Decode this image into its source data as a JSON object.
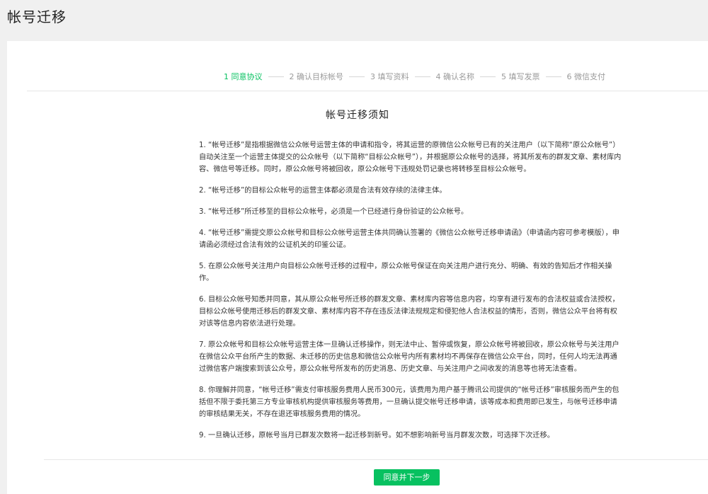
{
  "page": {
    "title": "帐号迁移"
  },
  "steps": [
    {
      "label": "1 同意协议",
      "active": true
    },
    {
      "label": "2 确认目标帐号",
      "active": false
    },
    {
      "label": "3 填写资料",
      "active": false
    },
    {
      "label": "4 确认名称",
      "active": false
    },
    {
      "label": "5 填写发票",
      "active": false
    },
    {
      "label": "6 微信支付",
      "active": false
    }
  ],
  "notice": {
    "title": "帐号迁移须知",
    "terms": [
      "1. “帐号迁移”是指根据微信公众帐号运营主体的申请和指令，将其运营的原微信公众帐号已有的关注用户（以下简称“原公众帐号”）自动关注至一个运营主体提交的公众帐号（以下简称“目标公众帐号”），并根据原公众帐号的选择，将其所发布的群发文章、素材库内容、微信号等迁移。同时，原公众帐号将被回收，原公众帐号下违规处罚记录也将转移至目标公众帐号。",
      "2. “帐号迁移”的目标公众帐号的运营主体都必须是合法有效存续的法律主体。",
      "3. “帐号迁移”所迁移至的目标公众帐号，必须是一个已经进行身份验证的公众帐号。",
      "4. “帐号迁移”需提交原公众帐号和目标公众帐号运营主体共同确认签署的《微信公众帐号迁移申请函》（申请函内容可参考模版），申请函必须经过合法有效的公证机关的印鉴公证。",
      "5. 在原公众帐号关注用户向目标公众帐号迁移的过程中，原公众帐号保证在向关注用户进行充分、明确、有效的告知后才作相关操作。",
      "6. 目标公众帐号知悉并同意，其从原公众帐号所迁移的群发文章、素材库内容等信息内容，均享有进行发布的合法权益或合法授权，目标公众帐号使用迁移后的群发文章、素材库内容不存在违反法律法规规定和侵犯他人合法权益的情形，否则，微信公众平台将有权对该等信息内容依法进行处理。",
      "7. 原公众帐号和目标公众帐号运营主体一旦确认迁移操作，则无法中止、暂停或恢复，原公众帐号将被回收，原公众帐号与关注用户在微信公众平台所产生的数据、未迁移的历史信息和微信公众帐号内所有素材均不再保存在微信公众平台，同时，任何人均无法再通过微信客户端搜索到该公众号，原公众帐号所发布的历史消息、历史文章、与关注用户之间收发的消息等也将无法查看。",
      "8. 你理解并同意，“帐号迁移”需支付审核服务费用人民币300元，该费用为用户基于腾讯公司提供的“帐号迁移”审核服务而产生的包括但不限于委托第三方专业审核机构提供审核服务等费用，一旦确认提交帐号迁移申请，该等成本和费用即已发生，与帐号迁移申请的审核结果无关，不存在退还审核服务费用的情况。",
      "9. 一旦确认迁移，原帐号当月已群发次数将一起迁移到新号。如不想影响新号当月群发次数，可选择下次迁移。"
    ]
  },
  "actions": {
    "next_label": "同意并下一步"
  },
  "colors": {
    "accent": "#07c160",
    "background": "#f0f0f0",
    "card": "#ffffff"
  }
}
